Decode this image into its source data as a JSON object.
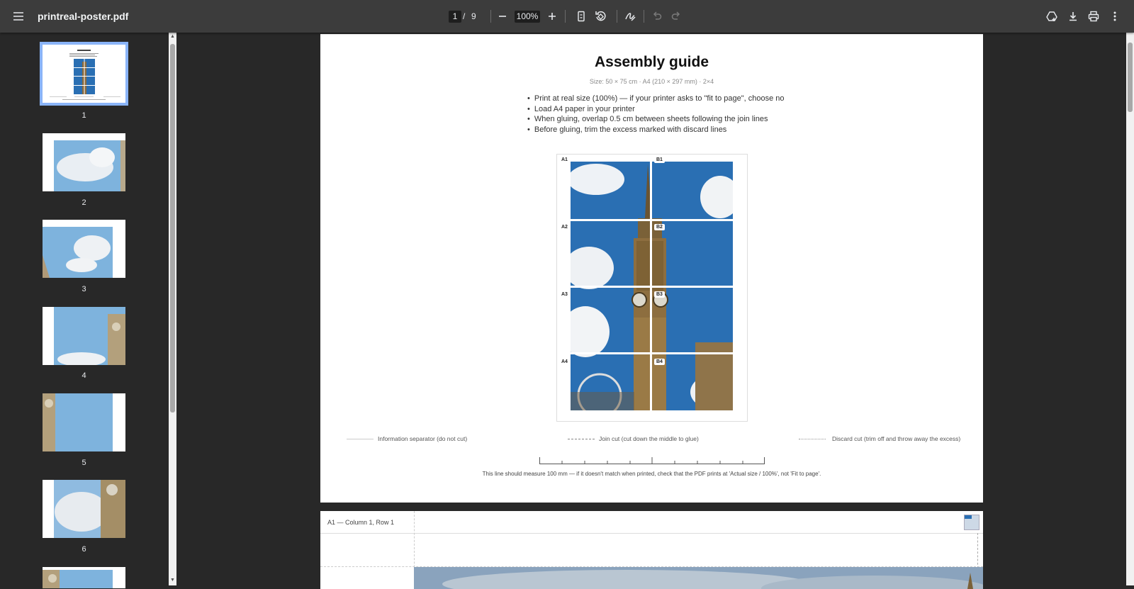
{
  "toolbar": {
    "filename": "printreal-poster.pdf",
    "page_current": "1",
    "page_sep": "/",
    "page_total": "9",
    "zoom": "100%"
  },
  "sidebar": {
    "thumbnails": [
      {
        "label": "1",
        "selected": true
      },
      {
        "label": "2"
      },
      {
        "label": "3"
      },
      {
        "label": "4"
      },
      {
        "label": "5"
      },
      {
        "label": "6"
      }
    ]
  },
  "page1": {
    "title": "Assembly guide",
    "subtitle": "Size: 50 × 75 cm  ·  A4 (210 × 297 mm)  ·  2×4",
    "bullets": [
      "Print at real size (100%) — if your printer asks to \"fit to page\", choose no",
      "Load A4 paper in your printer",
      "When gluing, overlap 0.5 cm between sheets following the join lines",
      "Before gluing, trim the excess marked with discard lines"
    ],
    "tiles": [
      "A1",
      "B1",
      "A2",
      "B2",
      "A3",
      "B3",
      "A4",
      "B4"
    ],
    "legend": {
      "info": "Information separator (do not cut)",
      "join": "Join cut (cut down the middle to glue)",
      "discard": "Discard cut (trim off and throw away the excess)"
    },
    "ruler_note": "This line should measure 100 mm — if it doesn't match when printed, check that the PDF prints at 'Actual size / 100%', not 'Fit to page'."
  },
  "page2": {
    "header": "A1 — Column 1, Row 1"
  },
  "colors": {
    "toolbar": "#3c3c3c",
    "background": "#282828",
    "selection": "#8ab4f8",
    "sky": "#2a6fb3"
  }
}
